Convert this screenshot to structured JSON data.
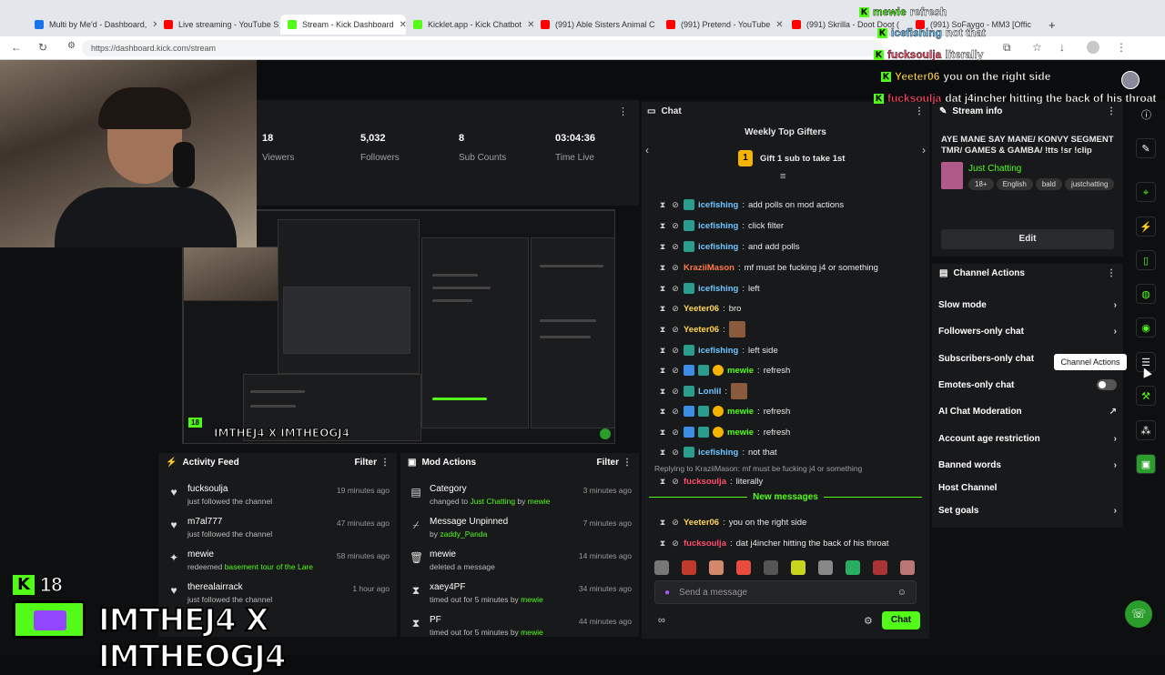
{
  "browser": {
    "tabs": [
      {
        "label": "Multi by Me'd - Dashboard,",
        "color": "#1a73e8"
      },
      {
        "label": "Live streaming - YouTube S",
        "color": "#ff0000"
      },
      {
        "label": "Stream - Kick Dashboard",
        "color": "#53fc18"
      },
      {
        "label": "Kicklet.app - Kick Chatbot",
        "color": "#53fc18"
      },
      {
        "label": "(991) Able Sisters Animal C",
        "color": "#ff0000"
      },
      {
        "label": "(991) Pretend - YouTube",
        "color": "#ff0000"
      },
      {
        "label": "(991) Skrilla - Doot Doot (",
        "color": "#ff0000"
      },
      {
        "label": "(991) SoFaygo - MM3 [Offic",
        "color": "#ff0000"
      }
    ],
    "url": "https://dashboard.kick.com/stream"
  },
  "stats": [
    {
      "value": "18",
      "label": "Viewers"
    },
    {
      "value": "5,032",
      "label": "Followers"
    },
    {
      "value": "8",
      "label": "Sub Counts"
    },
    {
      "value": "03:04:36",
      "label": "Time Live"
    }
  ],
  "activity": {
    "title": "Activity Feed",
    "filter": "Filter",
    "items": [
      {
        "name": "fucksoulja",
        "sub": "just followed the channel",
        "time": "19 minutes ago",
        "icon": "heart-icon"
      },
      {
        "name": "m7al777",
        "sub": "just followed the channel",
        "time": "47 minutes ago",
        "icon": "heart-icon"
      },
      {
        "name": "mewie",
        "sub_prefix": "redeemed ",
        "sub_highlight": "basement tour of the Lare",
        "time": "58 minutes ago",
        "icon": "points-icon"
      },
      {
        "name": "therealairrack",
        "sub": "just followed the channel",
        "time": "1 hour ago",
        "icon": "heart-icon"
      }
    ]
  },
  "mod": {
    "title": "Mod Actions",
    "filter": "Filter",
    "items": [
      {
        "name": "Category",
        "sub_prefix": "changed to ",
        "sub_highlight": "Just Chatting",
        "sub_mid": " by ",
        "sub_user": "mewie",
        "time": "3 minutes ago"
      },
      {
        "name": "Message Unpinned",
        "sub_prefix": "by ",
        "sub_user": "zaddy_Panda",
        "time": "7 minutes ago"
      },
      {
        "name": "mewie",
        "sub_prefix": "deleted a message",
        "time": "14 minutes ago"
      },
      {
        "name": "xaey4PF",
        "sub_prefix": "timed out for 5 minutes by ",
        "sub_user": "mewie",
        "time": "34 minutes ago"
      },
      {
        "name": "PF",
        "sub_prefix": "timed out for 5 minutes by ",
        "sub_user": "mewie",
        "time": "44 minutes ago"
      }
    ]
  },
  "brand": {
    "count": "18",
    "text": "IMTHEJ4 X IMTHEOGJ4"
  },
  "preview": {
    "overlay_text": "IMTHEJ4 X IMTHEOGJ4",
    "count": "18"
  },
  "chat": {
    "title": "Chat",
    "gifters_title": "Weekly Top Gifters",
    "gift_cta": "Gift 1 sub to take 1st",
    "gift_rank": "1",
    "messages": [
      {
        "user": "icefishing",
        "color": "#6ec6ff",
        "text": "add polls on mod actions"
      },
      {
        "user": "icefishing",
        "color": "#6ec6ff",
        "text": "click filter"
      },
      {
        "user": "icefishing",
        "color": "#6ec6ff",
        "text": "and add polls"
      },
      {
        "user": "KraziiMason",
        "color": "#ff7a45",
        "text": "mf must be fucking j4 or something"
      },
      {
        "user": "icefishing",
        "color": "#6ec6ff",
        "text": "left"
      },
      {
        "user": "Yeeter06",
        "color": "#ffd54f",
        "text": "bro"
      },
      {
        "user": "Yeeter06",
        "color": "#ffd54f",
        "text": ""
      },
      {
        "user": "icefishing",
        "color": "#6ec6ff",
        "text": "left side"
      },
      {
        "user": "mewie",
        "color": "#53fc18",
        "text": "refresh"
      },
      {
        "user": "LonliI",
        "color": "#6ec6ff",
        "text": ""
      },
      {
        "user": "mewie",
        "color": "#53fc18",
        "text": "refresh"
      },
      {
        "user": "mewie",
        "color": "#53fc18",
        "text": "refresh"
      },
      {
        "user": "icefishing",
        "color": "#6ec6ff",
        "text": "not that"
      }
    ],
    "reply_context": "Replying to KraziiMason: mf must be fucking j4 or something",
    "reply_msg": {
      "user": "fucksoulja",
      "color": "#ff4d6d",
      "text": "literally"
    },
    "new_messages": "New messages",
    "after": [
      {
        "user": "Yeeter06",
        "color": "#ffd54f",
        "text": "you on the right side"
      },
      {
        "user": "fucksoulja",
        "color": "#ff4d6d",
        "text": "dat j4incher hitting the back of his throat"
      }
    ],
    "send_placeholder": "Send a message",
    "chat_button": "Chat"
  },
  "stream_info": {
    "title": "Stream info",
    "stream_title": "AYE MANE SAY MANE/ KONVY SEGMENT TMR/ GAMES & GAMBA/ !tts !sr !clip",
    "category": "Just Chatting",
    "tags": [
      "18+",
      "English",
      "bald",
      "justchatting"
    ],
    "edit": "Edit"
  },
  "channel_actions": {
    "title": "Channel Actions",
    "items": [
      {
        "label": "Slow mode",
        "control": "arrow"
      },
      {
        "label": "Followers-only chat",
        "control": "arrow"
      },
      {
        "label": "Subscribers-only chat",
        "control": "none"
      },
      {
        "label": "Emotes-only chat",
        "control": "toggle"
      },
      {
        "label": "AI Chat Moderation",
        "control": "external"
      },
      {
        "label": "Account age restriction",
        "control": "arrow"
      },
      {
        "label": "Banned words",
        "control": "arrow"
      },
      {
        "label": "Host Channel",
        "control": "none"
      },
      {
        "label": "Set goals",
        "control": "arrow"
      }
    ]
  },
  "tooltip": "Channel Actions",
  "overlay_alerts": [
    {
      "user": "mewie",
      "text": "refresh"
    },
    {
      "user": "icefishing",
      "text": "not that"
    },
    {
      "user": "fucksoulja",
      "text": "literally"
    },
    {
      "user": "Yeeter06",
      "text": "you on the right side"
    },
    {
      "user": "fucksoulja",
      "text": "dat j4incher hitting the back of his throat"
    }
  ]
}
